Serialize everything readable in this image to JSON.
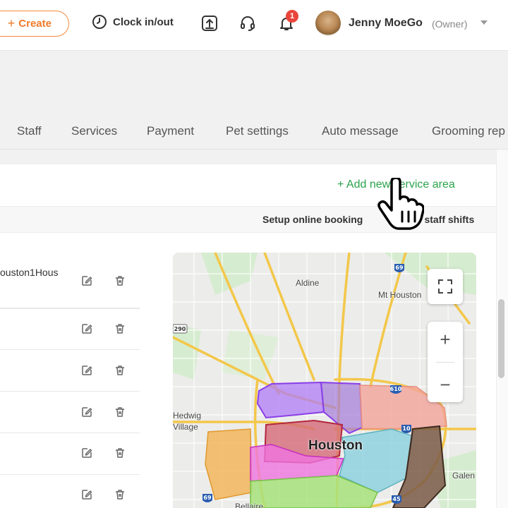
{
  "header": {
    "create_label": "Create",
    "create_plus": "+",
    "clock_label": "Clock in/out",
    "notification_count": "1",
    "user_name": "Jenny MoeGo",
    "user_role": "(Owner)"
  },
  "tabs": [
    "Staff",
    "Services",
    "Payment",
    "Pet settings",
    "Auto message",
    "Grooming rep"
  ],
  "service_area": {
    "add_label": "+ Add new service area",
    "setup_online_booking": "Setup online booking",
    "staff_shifts_label": "p staff shifts",
    "rows": [
      {
        "name": "ouston1Hous"
      },
      {
        "name": ""
      },
      {
        "name": ""
      },
      {
        "name": ""
      },
      {
        "name": ""
      },
      {
        "name": ""
      }
    ]
  },
  "map": {
    "labels": {
      "aldine": "Aldine",
      "mt_houston": "Mt Houston",
      "hedwig": "Hedwig",
      "village": "Village",
      "houston": "Houston",
      "galena": "Galen",
      "bellaire": "Bellaire"
    },
    "shields": {
      "i69_top": "69",
      "hw290": "290",
      "i610_right": "610",
      "i10": "10",
      "i69_bottom": "69",
      "i45": "45"
    },
    "zoom_in": "+",
    "zoom_out": "−",
    "zone_colors": [
      "#9b5cf0",
      "#e88a8a",
      "#d9576a",
      "#f0b34a",
      "#e65ad6",
      "#7cc9d6",
      "#6b4a3c",
      "#9ee06e"
    ]
  }
}
